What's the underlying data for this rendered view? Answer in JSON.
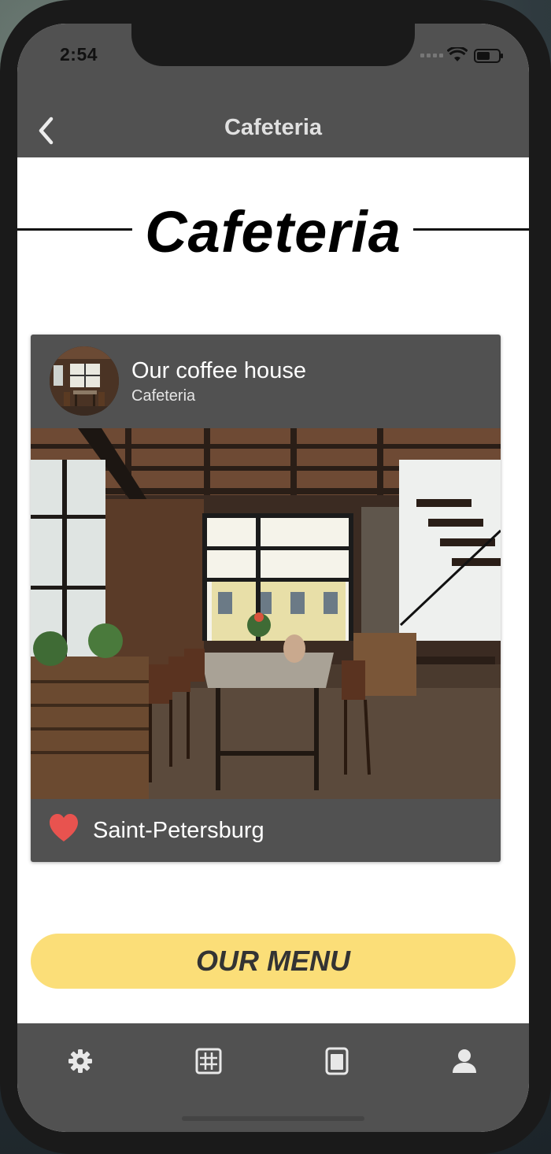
{
  "status_bar": {
    "time": "2:54"
  },
  "nav": {
    "title": "Cafeteria",
    "back_icon": "chevron-left-icon"
  },
  "hero": {
    "title": "Cafeteria"
  },
  "card": {
    "title": "Our coffee house",
    "subtitle": "Cafeteria",
    "location": "Saint-Petersburg",
    "heart_color": "#e8534f"
  },
  "menu_button": {
    "label": "OUR MENU",
    "color": "#fbde78"
  },
  "tabbar": {
    "tabs": [
      {
        "icon": "gear-icon"
      },
      {
        "icon": "grid-icon"
      },
      {
        "icon": "tablet-icon"
      },
      {
        "icon": "user-icon"
      }
    ]
  },
  "colors": {
    "header": "#515151",
    "card": "#515151",
    "background": "#ffffff"
  }
}
